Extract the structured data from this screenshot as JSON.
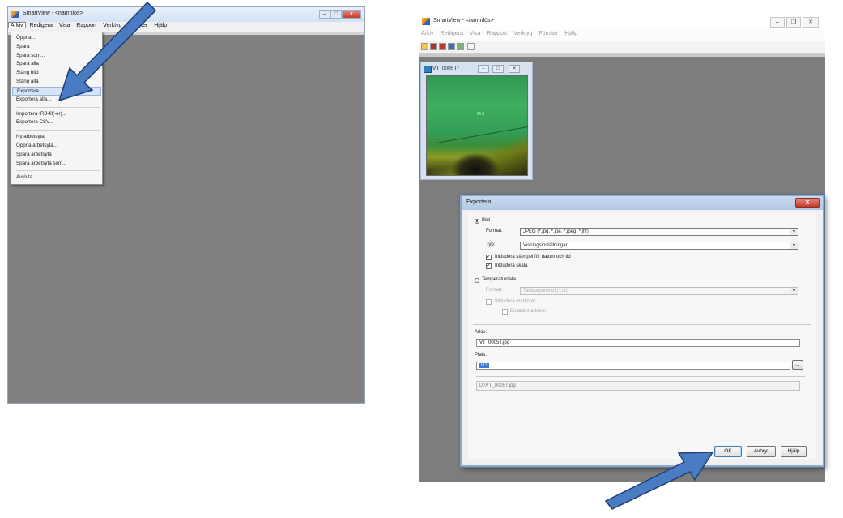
{
  "left_window": {
    "title": "SmartView - <namnlös>",
    "close_glyph": "x",
    "menu": [
      "Arkiv",
      "Redigera",
      "Visa",
      "Rapport",
      "Verktyg",
      "Fönster",
      "Hjälp"
    ],
    "file_menu": {
      "group1": [
        "Öppna...",
        "Spara",
        "Spara som...",
        "Spara alla",
        "Stäng bild",
        "Stäng alla"
      ],
      "highlighted": "Exportera...",
      "group1b": [
        "Exportera alla..."
      ],
      "group2": [
        "Importera IRB-fil(-er)...",
        "Exportera CSV..."
      ],
      "group3": [
        "Ny arbetsyta",
        "Öppna arbetsyta...",
        "Spara arbetsyta",
        "Spara arbetsyta som..."
      ],
      "group4": [
        "Avsluta..."
      ]
    }
  },
  "right_window": {
    "title": "SmartView - <namnlös>",
    "menu": [
      "Arkiv",
      "Redigera",
      "Visa",
      "Rapport",
      "Verktyg",
      "Fönster",
      "Hjälp"
    ],
    "image_window_title": "VT_0005T*",
    "spot_label": "IR:5"
  },
  "export_dialog": {
    "title": "Exportera",
    "close_glyph": "X",
    "bild_label": "Bild",
    "format_label": "Format:",
    "format_value": "JPEG (*.jpg, *.jpe, *.jpeg, *.jfif)",
    "typ_label": "Typ:",
    "typ_value": "Visningsinställningar",
    "stamp_label": "Inkludera stämpel för datum och tid",
    "scale_label": "Inkludera skala",
    "tempdata_label": "Temperaturdata",
    "tempdata_format_label": "Format:",
    "tempdata_format_value": "Tabbseparerad (*.txt)",
    "markers_label": "Inkludera markörer",
    "only_markers_label": "Endast markörer",
    "arkiv_label": "Arkiv:",
    "arkiv_value": "VT_0005T.jpg",
    "plats_label": "Plats:",
    "plats_value": "D:\\",
    "browse_label": "...",
    "path_value": "D:\\VT_0005T.jpg",
    "ok_label": "OK",
    "cancel_label": "Avbryt",
    "help_label": "Hjälp"
  },
  "colors": {
    "arrow_fill": "#4a7cc4",
    "arrow_stroke": "#1f3f72",
    "workspace": "#808080"
  }
}
